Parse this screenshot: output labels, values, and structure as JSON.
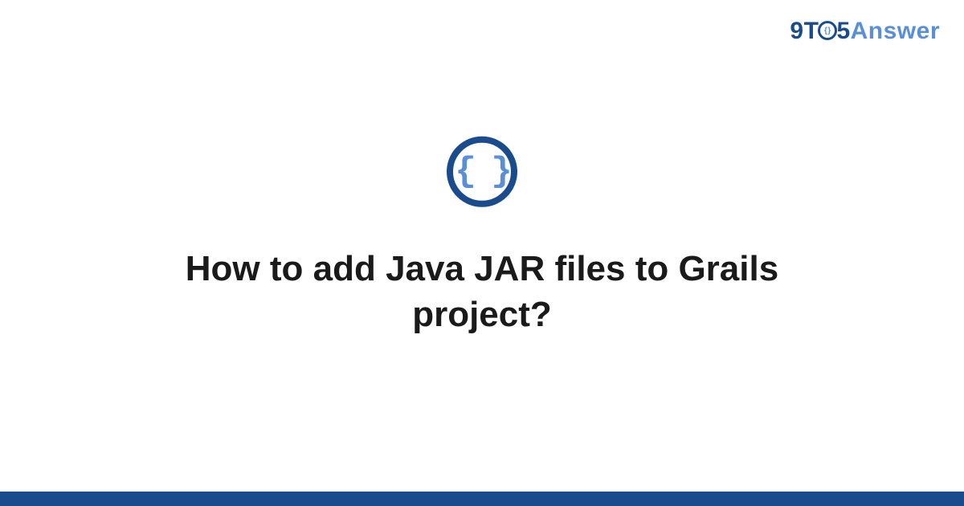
{
  "logo": {
    "part1": "9T",
    "o_inner": "{}",
    "part2": "5",
    "part3": "Answer"
  },
  "icon": {
    "braces": "{ }"
  },
  "title": "How to add Java JAR files to Grails project?",
  "colors": {
    "primary": "#1a4b8c",
    "secondary": "#5a8fd6"
  }
}
